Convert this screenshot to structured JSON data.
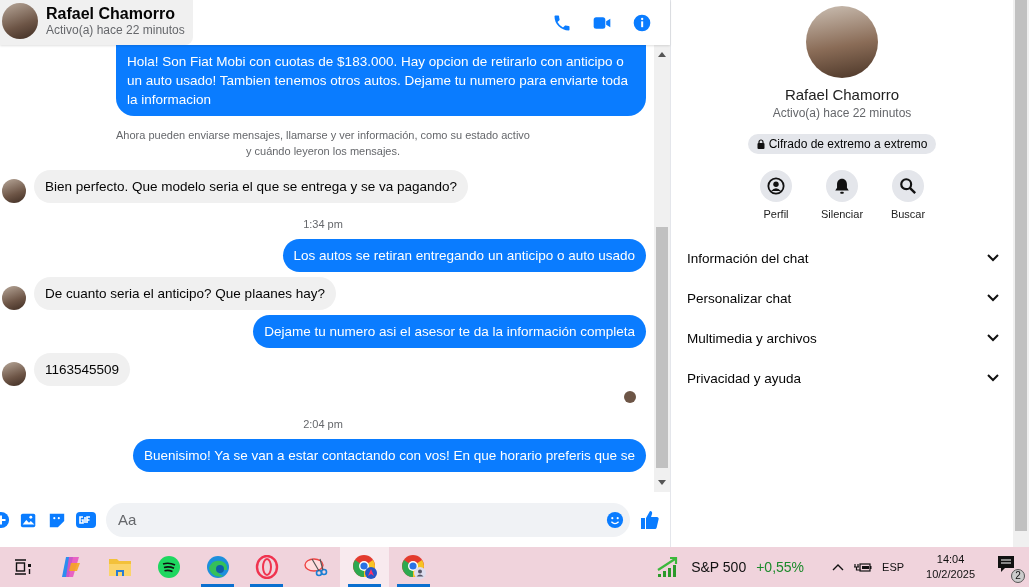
{
  "header": {
    "name": "Rafael Chamorro",
    "status": "Activo(a) hace 22 minutos"
  },
  "messages": [
    {
      "kind": "outgoing",
      "text": "Hola! Son Fiat Mobi con cuotas de $183.000. Hay opcion de retirarlo con anticipo o un auto usado! Tambien tenemos otros autos. Dejame tu numero para enviarte toda la informacion"
    },
    {
      "kind": "system",
      "text": "Ahora pueden enviarse mensajes, llamarse y ver información, como su estado activo y cuándo leyeron los mensajes."
    },
    {
      "kind": "incoming",
      "text": "Bien perfecto. Que modelo seria el que se entrega y se va pagando?"
    },
    {
      "kind": "time",
      "text": "1:34 pm"
    },
    {
      "kind": "outgoing",
      "text": "Los autos se retiran entregando un anticipo o auto usado"
    },
    {
      "kind": "incoming",
      "text": "De cuanto seria el anticipo? Que plaanes hay?"
    },
    {
      "kind": "outgoing",
      "text": "Dejame tu numero asi el asesor te da la información completa"
    },
    {
      "kind": "incoming",
      "text": "1163545509"
    },
    {
      "kind": "seen"
    },
    {
      "kind": "time",
      "text": "2:04 pm"
    },
    {
      "kind": "outgoing",
      "text": "Buenisimo! Ya se van a estar contactando con vos! En que horario preferis que se"
    }
  ],
  "composer": {
    "placeholder": "Aa"
  },
  "profile": {
    "name": "Rafael Chamorro",
    "status": "Activo(a) hace 22 minutos",
    "encryption": "Cifrado de extremo a extremo",
    "actions": [
      {
        "kind": "profile",
        "label": "Perfil"
      },
      {
        "kind": "mute",
        "label": "Silenciar"
      },
      {
        "kind": "search",
        "label": "Buscar"
      }
    ],
    "sections": [
      {
        "label": "Información del chat",
        "expanded": false
      },
      {
        "label": "Personalizar chat",
        "expanded": false
      },
      {
        "label": "Multimedia y archivos",
        "expanded": false
      },
      {
        "label": "Privacidad y ayuda",
        "expanded": false
      }
    ]
  },
  "taskbar": {
    "apps": [
      {
        "kind": "taskview",
        "running": false,
        "selected": false
      },
      {
        "kind": "copilot",
        "running": false,
        "selected": false
      },
      {
        "kind": "files",
        "running": false,
        "selected": false
      },
      {
        "kind": "spotify",
        "running": false,
        "selected": false
      },
      {
        "kind": "edge",
        "running": true,
        "selected": false
      },
      {
        "kind": "opera",
        "running": true,
        "selected": false
      },
      {
        "kind": "snipping",
        "running": false,
        "selected": false
      },
      {
        "kind": "chrome",
        "running": true,
        "selected": true
      },
      {
        "kind": "chrome-profile",
        "running": true,
        "selected": false
      }
    ],
    "stock": {
      "name": "S&P 500",
      "change": "+0,55%"
    },
    "language": "ESP",
    "time": "14:04",
    "date": "10/2/2025",
    "notifications": "2"
  }
}
